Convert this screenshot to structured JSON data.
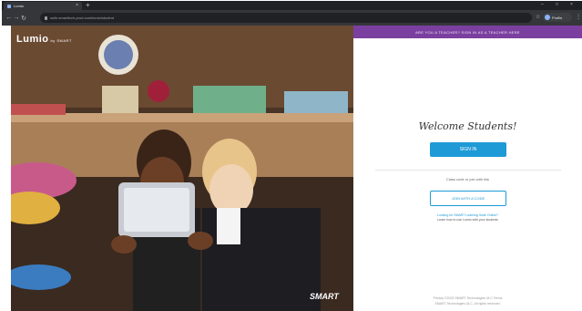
{
  "browser": {
    "tab_title": "Lumio",
    "url": "suite.smarttech-prod.com/lumio/student",
    "profile_label": "Profile",
    "new_tab": "+",
    "tab_close": "×",
    "minimize": "–",
    "maximize": "□",
    "close": "×",
    "back": "←",
    "forward": "→",
    "reload": "↻",
    "star": "☆",
    "menu": "⋮"
  },
  "hero": {
    "logo": "Lumio",
    "logo_suffix": "by SMART",
    "brand": "SMART"
  },
  "panel": {
    "banner": "ARE YOU A TEACHER? SIGN IN AS A TEACHER HERE",
    "welcome": "Welcome Students!",
    "signin_label": "SIGN IN",
    "or_text": "Class code or join with link",
    "join_label": "JOIN WITH A CODE",
    "help_line1": "Looking for SMART Learning Suite Online?",
    "help_line2": "Learn how to use Lumio with your students",
    "footer_line1": "Privacy   ©2023 SMART Technologies ULC   Terms",
    "footer_line2": "SMART Technologies ULC. All rights reserved."
  },
  "colors": {
    "banner": "#7b3fa0",
    "primary_button": "#1e9ad6",
    "browser_chrome": "#35363a"
  }
}
